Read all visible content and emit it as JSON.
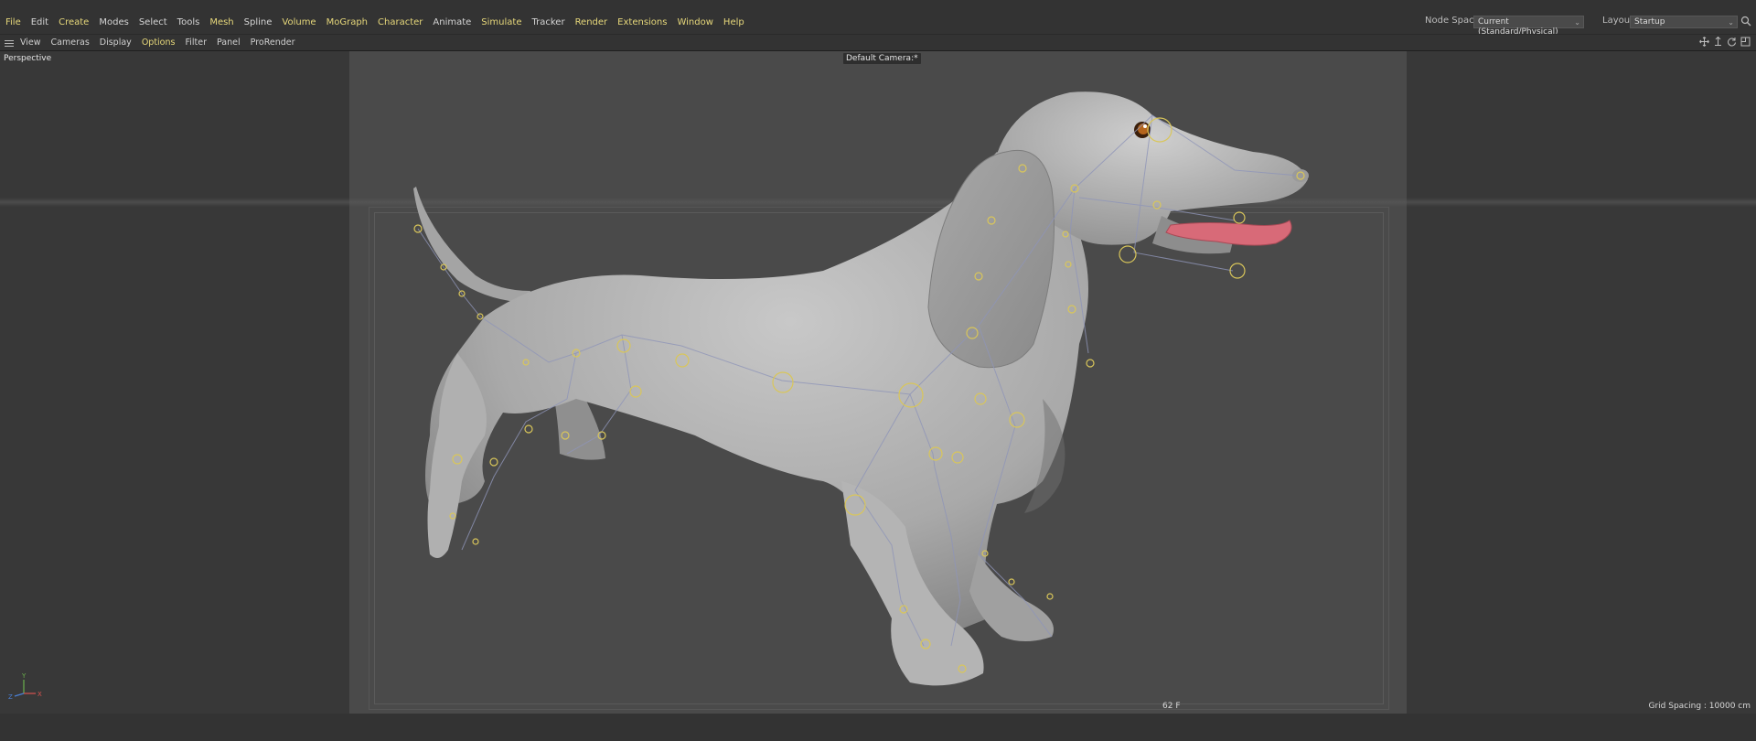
{
  "menubar": {
    "items": [
      {
        "label": "File",
        "accent": true
      },
      {
        "label": "Edit",
        "accent": false
      },
      {
        "label": "Create",
        "accent": true
      },
      {
        "label": "Modes",
        "accent": false
      },
      {
        "label": "Select",
        "accent": false
      },
      {
        "label": "Tools",
        "accent": false
      },
      {
        "label": "Mesh",
        "accent": true
      },
      {
        "label": "Spline",
        "accent": false
      },
      {
        "label": "Volume",
        "accent": true
      },
      {
        "label": "MoGraph",
        "accent": true
      },
      {
        "label": "Character",
        "accent": true
      },
      {
        "label": "Animate",
        "accent": false
      },
      {
        "label": "Simulate",
        "accent": true
      },
      {
        "label": "Tracker",
        "accent": false
      },
      {
        "label": "Render",
        "accent": true
      },
      {
        "label": "Extensions",
        "accent": true
      },
      {
        "label": "Window",
        "accent": true
      },
      {
        "label": "Help",
        "accent": true
      }
    ],
    "node_space_label": "Node Space:",
    "node_space_value": "Current (Standard/Physical)",
    "layout_label": "Layout:",
    "layout_value": "Startup",
    "search_icon": "search-icon"
  },
  "viewport_toolbar": {
    "menu_icon": "hamburger-icon",
    "items": [
      {
        "label": "View",
        "accent": false
      },
      {
        "label": "Cameras",
        "accent": false
      },
      {
        "label": "Display",
        "accent": false
      },
      {
        "label": "Options",
        "accent": true
      },
      {
        "label": "Filter",
        "accent": false
      },
      {
        "label": "Panel",
        "accent": false
      },
      {
        "label": "ProRender",
        "accent": false
      }
    ],
    "nav_icons": [
      "move-view-icon",
      "dolly-view-icon",
      "rotate-view-icon",
      "maximize-view-icon"
    ]
  },
  "viewport": {
    "projection_label": "Perspective",
    "camera_label": "Default Camera",
    "camera_suffix": ":*",
    "frame_label": "62 F",
    "grid_spacing_label": "Grid Spacing : 10000 cm",
    "axis_labels": {
      "y": "Y",
      "z": "Z",
      "x": "X"
    },
    "scene_object": "dachshund-model"
  },
  "colors": {
    "accent_menu": "#e6d77a",
    "joint_yellow": "#d9c65a",
    "tongue": "#d86a78",
    "model_gray": "#b9b9b9"
  }
}
